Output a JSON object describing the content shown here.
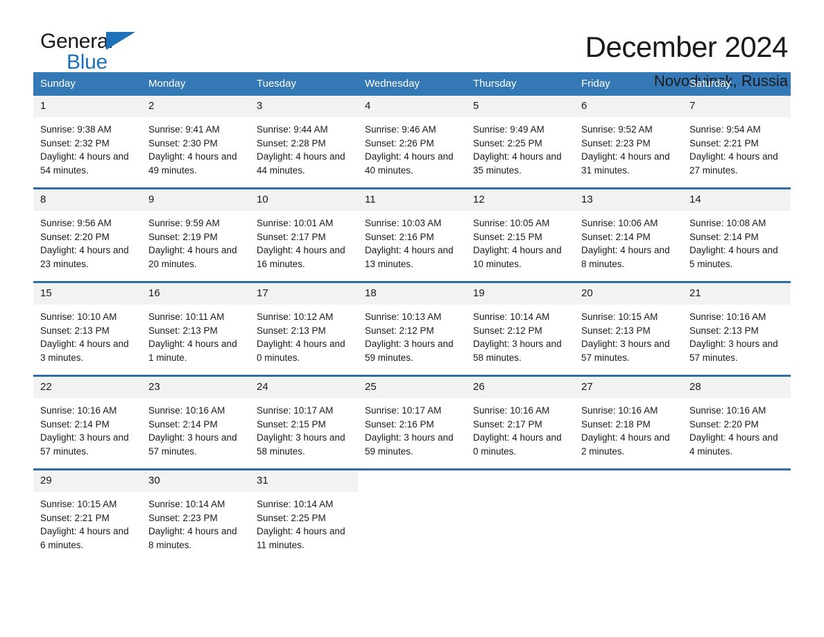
{
  "brand": {
    "name_top": "General",
    "name_bottom": "Blue",
    "accent_color": "#1b72b8"
  },
  "header": {
    "title": "December 2024",
    "subtitle": "Novodvinsk, Russia"
  },
  "calendar": {
    "header_bg": "#3479b5",
    "row_divider_color": "#2e6da4",
    "daynum_bg": "#f2f2f2",
    "weekday_headers": [
      "Sunday",
      "Monday",
      "Tuesday",
      "Wednesday",
      "Thursday",
      "Friday",
      "Saturday"
    ],
    "weeks": [
      [
        {
          "day": "1",
          "sunrise": "Sunrise: 9:38 AM",
          "sunset": "Sunset: 2:32 PM",
          "daylight": "Daylight: 4 hours and 54 minutes."
        },
        {
          "day": "2",
          "sunrise": "Sunrise: 9:41 AM",
          "sunset": "Sunset: 2:30 PM",
          "daylight": "Daylight: 4 hours and 49 minutes."
        },
        {
          "day": "3",
          "sunrise": "Sunrise: 9:44 AM",
          "sunset": "Sunset: 2:28 PM",
          "daylight": "Daylight: 4 hours and 44 minutes."
        },
        {
          "day": "4",
          "sunrise": "Sunrise: 9:46 AM",
          "sunset": "Sunset: 2:26 PM",
          "daylight": "Daylight: 4 hours and 40 minutes."
        },
        {
          "day": "5",
          "sunrise": "Sunrise: 9:49 AM",
          "sunset": "Sunset: 2:25 PM",
          "daylight": "Daylight: 4 hours and 35 minutes."
        },
        {
          "day": "6",
          "sunrise": "Sunrise: 9:52 AM",
          "sunset": "Sunset: 2:23 PM",
          "daylight": "Daylight: 4 hours and 31 minutes."
        },
        {
          "day": "7",
          "sunrise": "Sunrise: 9:54 AM",
          "sunset": "Sunset: 2:21 PM",
          "daylight": "Daylight: 4 hours and 27 minutes."
        }
      ],
      [
        {
          "day": "8",
          "sunrise": "Sunrise: 9:56 AM",
          "sunset": "Sunset: 2:20 PM",
          "daylight": "Daylight: 4 hours and 23 minutes."
        },
        {
          "day": "9",
          "sunrise": "Sunrise: 9:59 AM",
          "sunset": "Sunset: 2:19 PM",
          "daylight": "Daylight: 4 hours and 20 minutes."
        },
        {
          "day": "10",
          "sunrise": "Sunrise: 10:01 AM",
          "sunset": "Sunset: 2:17 PM",
          "daylight": "Daylight: 4 hours and 16 minutes."
        },
        {
          "day": "11",
          "sunrise": "Sunrise: 10:03 AM",
          "sunset": "Sunset: 2:16 PM",
          "daylight": "Daylight: 4 hours and 13 minutes."
        },
        {
          "day": "12",
          "sunrise": "Sunrise: 10:05 AM",
          "sunset": "Sunset: 2:15 PM",
          "daylight": "Daylight: 4 hours and 10 minutes."
        },
        {
          "day": "13",
          "sunrise": "Sunrise: 10:06 AM",
          "sunset": "Sunset: 2:14 PM",
          "daylight": "Daylight: 4 hours and 8 minutes."
        },
        {
          "day": "14",
          "sunrise": "Sunrise: 10:08 AM",
          "sunset": "Sunset: 2:14 PM",
          "daylight": "Daylight: 4 hours and 5 minutes."
        }
      ],
      [
        {
          "day": "15",
          "sunrise": "Sunrise: 10:10 AM",
          "sunset": "Sunset: 2:13 PM",
          "daylight": "Daylight: 4 hours and 3 minutes."
        },
        {
          "day": "16",
          "sunrise": "Sunrise: 10:11 AM",
          "sunset": "Sunset: 2:13 PM",
          "daylight": "Daylight: 4 hours and 1 minute."
        },
        {
          "day": "17",
          "sunrise": "Sunrise: 10:12 AM",
          "sunset": "Sunset: 2:13 PM",
          "daylight": "Daylight: 4 hours and 0 minutes."
        },
        {
          "day": "18",
          "sunrise": "Sunrise: 10:13 AM",
          "sunset": "Sunset: 2:12 PM",
          "daylight": "Daylight: 3 hours and 59 minutes."
        },
        {
          "day": "19",
          "sunrise": "Sunrise: 10:14 AM",
          "sunset": "Sunset: 2:12 PM",
          "daylight": "Daylight: 3 hours and 58 minutes."
        },
        {
          "day": "20",
          "sunrise": "Sunrise: 10:15 AM",
          "sunset": "Sunset: 2:13 PM",
          "daylight": "Daylight: 3 hours and 57 minutes."
        },
        {
          "day": "21",
          "sunrise": "Sunrise: 10:16 AM",
          "sunset": "Sunset: 2:13 PM",
          "daylight": "Daylight: 3 hours and 57 minutes."
        }
      ],
      [
        {
          "day": "22",
          "sunrise": "Sunrise: 10:16 AM",
          "sunset": "Sunset: 2:14 PM",
          "daylight": "Daylight: 3 hours and 57 minutes."
        },
        {
          "day": "23",
          "sunrise": "Sunrise: 10:16 AM",
          "sunset": "Sunset: 2:14 PM",
          "daylight": "Daylight: 3 hours and 57 minutes."
        },
        {
          "day": "24",
          "sunrise": "Sunrise: 10:17 AM",
          "sunset": "Sunset: 2:15 PM",
          "daylight": "Daylight: 3 hours and 58 minutes."
        },
        {
          "day": "25",
          "sunrise": "Sunrise: 10:17 AM",
          "sunset": "Sunset: 2:16 PM",
          "daylight": "Daylight: 3 hours and 59 minutes."
        },
        {
          "day": "26",
          "sunrise": "Sunrise: 10:16 AM",
          "sunset": "Sunset: 2:17 PM",
          "daylight": "Daylight: 4 hours and 0 minutes."
        },
        {
          "day": "27",
          "sunrise": "Sunrise: 10:16 AM",
          "sunset": "Sunset: 2:18 PM",
          "daylight": "Daylight: 4 hours and 2 minutes."
        },
        {
          "day": "28",
          "sunrise": "Sunrise: 10:16 AM",
          "sunset": "Sunset: 2:20 PM",
          "daylight": "Daylight: 4 hours and 4 minutes."
        }
      ],
      [
        {
          "day": "29",
          "sunrise": "Sunrise: 10:15 AM",
          "sunset": "Sunset: 2:21 PM",
          "daylight": "Daylight: 4 hours and 6 minutes."
        },
        {
          "day": "30",
          "sunrise": "Sunrise: 10:14 AM",
          "sunset": "Sunset: 2:23 PM",
          "daylight": "Daylight: 4 hours and 8 minutes."
        },
        {
          "day": "31",
          "sunrise": "Sunrise: 10:14 AM",
          "sunset": "Sunset: 2:25 PM",
          "daylight": "Daylight: 4 hours and 11 minutes."
        },
        {
          "day": "",
          "sunrise": "",
          "sunset": "",
          "daylight": ""
        },
        {
          "day": "",
          "sunrise": "",
          "sunset": "",
          "daylight": ""
        },
        {
          "day": "",
          "sunrise": "",
          "sunset": "",
          "daylight": ""
        },
        {
          "day": "",
          "sunrise": "",
          "sunset": "",
          "daylight": ""
        }
      ]
    ]
  }
}
